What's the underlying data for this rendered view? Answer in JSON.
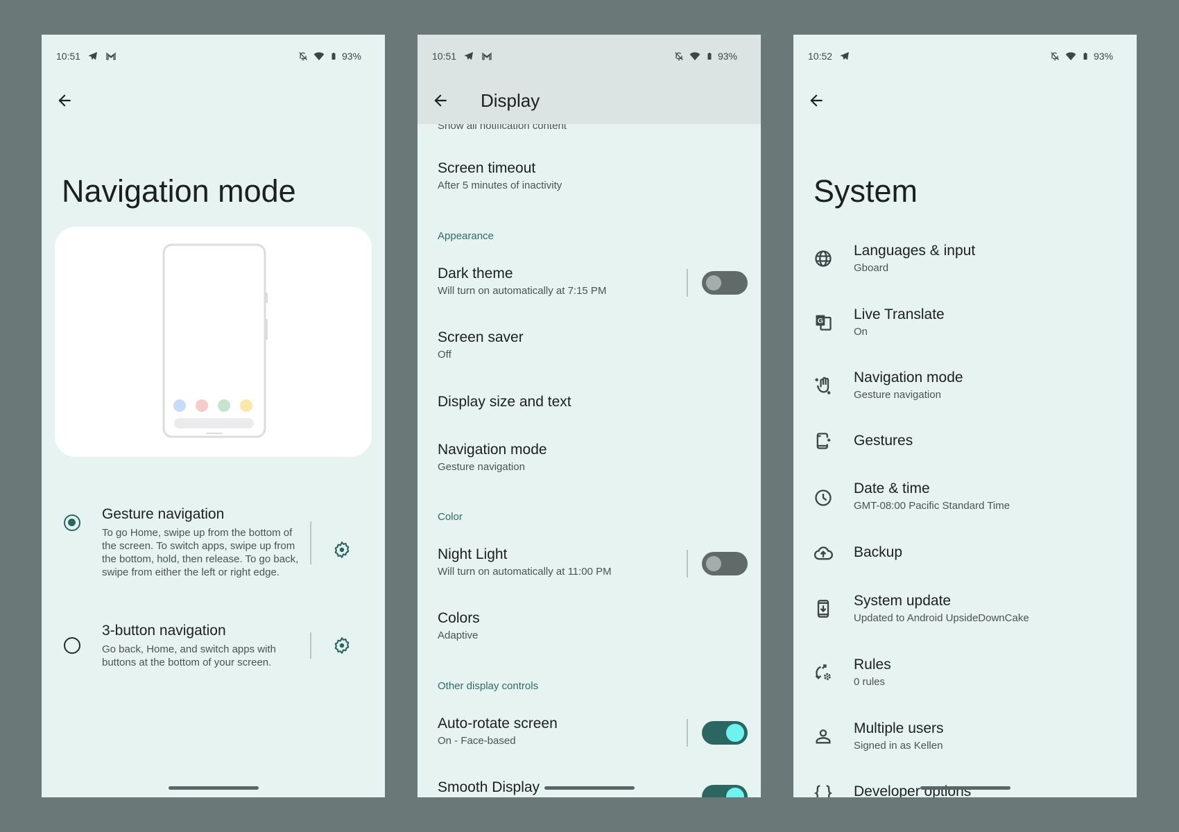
{
  "colors": {
    "background": "#6b7878",
    "panel": "#e7f3f1",
    "accent": "#2b6662",
    "toggle_on_knob": "#6ff1ef",
    "toggle_off_track": "#5f6a69"
  },
  "panels": [
    {
      "status": {
        "time": "10:51",
        "icons_left": [
          "telegram-icon",
          "gmail-icon"
        ],
        "icons_right": [
          "bell-off-icon",
          "wifi-icon",
          "battery-icon"
        ],
        "battery": "93%"
      },
      "title": "Navigation mode",
      "illustration": {
        "dots": [
          "#c9dbfb",
          "#f6cccb",
          "#c6e5cc",
          "#fbe7a8"
        ]
      },
      "options": [
        {
          "label": "Gesture navigation",
          "description": "To go Home, swipe up from the bottom of the screen. To switch apps, swipe up from the bottom, hold, then release. To go back, swipe from either the left or right edge.",
          "selected": true
        },
        {
          "label": "3-button navigation",
          "description": "Go back, Home, and switch apps with buttons at the bottom of your screen.",
          "selected": false
        }
      ]
    },
    {
      "status": {
        "time": "10:51",
        "icons_left": [
          "telegram-icon",
          "gmail-icon"
        ],
        "icons_right": [
          "bell-off-icon",
          "wifi-icon",
          "battery-icon"
        ],
        "battery": "93%"
      },
      "title": "Display",
      "clipped_text": "Show all notification content",
      "items": [
        {
          "title": "Screen timeout",
          "subtitle": "After 5 minutes of inactivity"
        },
        {
          "section": "Appearance"
        },
        {
          "title": "Dark theme",
          "subtitle": "Will turn on automatically at 7:15 PM",
          "toggle": false
        },
        {
          "title": "Screen saver",
          "subtitle": "Off"
        },
        {
          "title": "Display size and text"
        },
        {
          "title": "Navigation mode",
          "subtitle": "Gesture navigation"
        },
        {
          "section": "Color"
        },
        {
          "title": "Night Light",
          "subtitle": "Will turn on automatically at 11:00 PM",
          "toggle": false
        },
        {
          "title": "Colors",
          "subtitle": "Adaptive"
        },
        {
          "section": "Other display controls"
        },
        {
          "title": "Auto-rotate screen",
          "subtitle": "On - Face-based",
          "toggle": true
        },
        {
          "title": "Smooth Display",
          "toggle": true
        }
      ]
    },
    {
      "status": {
        "time": "10:52",
        "icons_left": [
          "telegram-icon"
        ],
        "icons_right": [
          "bell-off-icon",
          "wifi-icon",
          "battery-icon"
        ],
        "battery": "93%"
      },
      "title": "System",
      "items": [
        {
          "icon": "globe-icon",
          "title": "Languages & input",
          "subtitle": "Gboard"
        },
        {
          "icon": "translate-icon",
          "title": "Live Translate",
          "subtitle": "On"
        },
        {
          "icon": "gesture-hand-icon",
          "title": "Navigation mode",
          "subtitle": "Gesture navigation"
        },
        {
          "icon": "phone-sparkle-icon",
          "title": "Gestures"
        },
        {
          "icon": "clock-icon",
          "title": "Date & time",
          "subtitle": "GMT-08:00 Pacific Standard Time"
        },
        {
          "icon": "cloud-upload-icon",
          "title": "Backup"
        },
        {
          "icon": "system-update-icon",
          "title": "System update",
          "subtitle": "Updated to Android UpsideDownCake"
        },
        {
          "icon": "rules-icon",
          "title": "Rules",
          "subtitle": "0 rules"
        },
        {
          "icon": "person-icon",
          "title": "Multiple users",
          "subtitle": "Signed in as Kellen"
        },
        {
          "icon": "code-braces-icon",
          "title": "Developer options"
        }
      ]
    }
  ]
}
